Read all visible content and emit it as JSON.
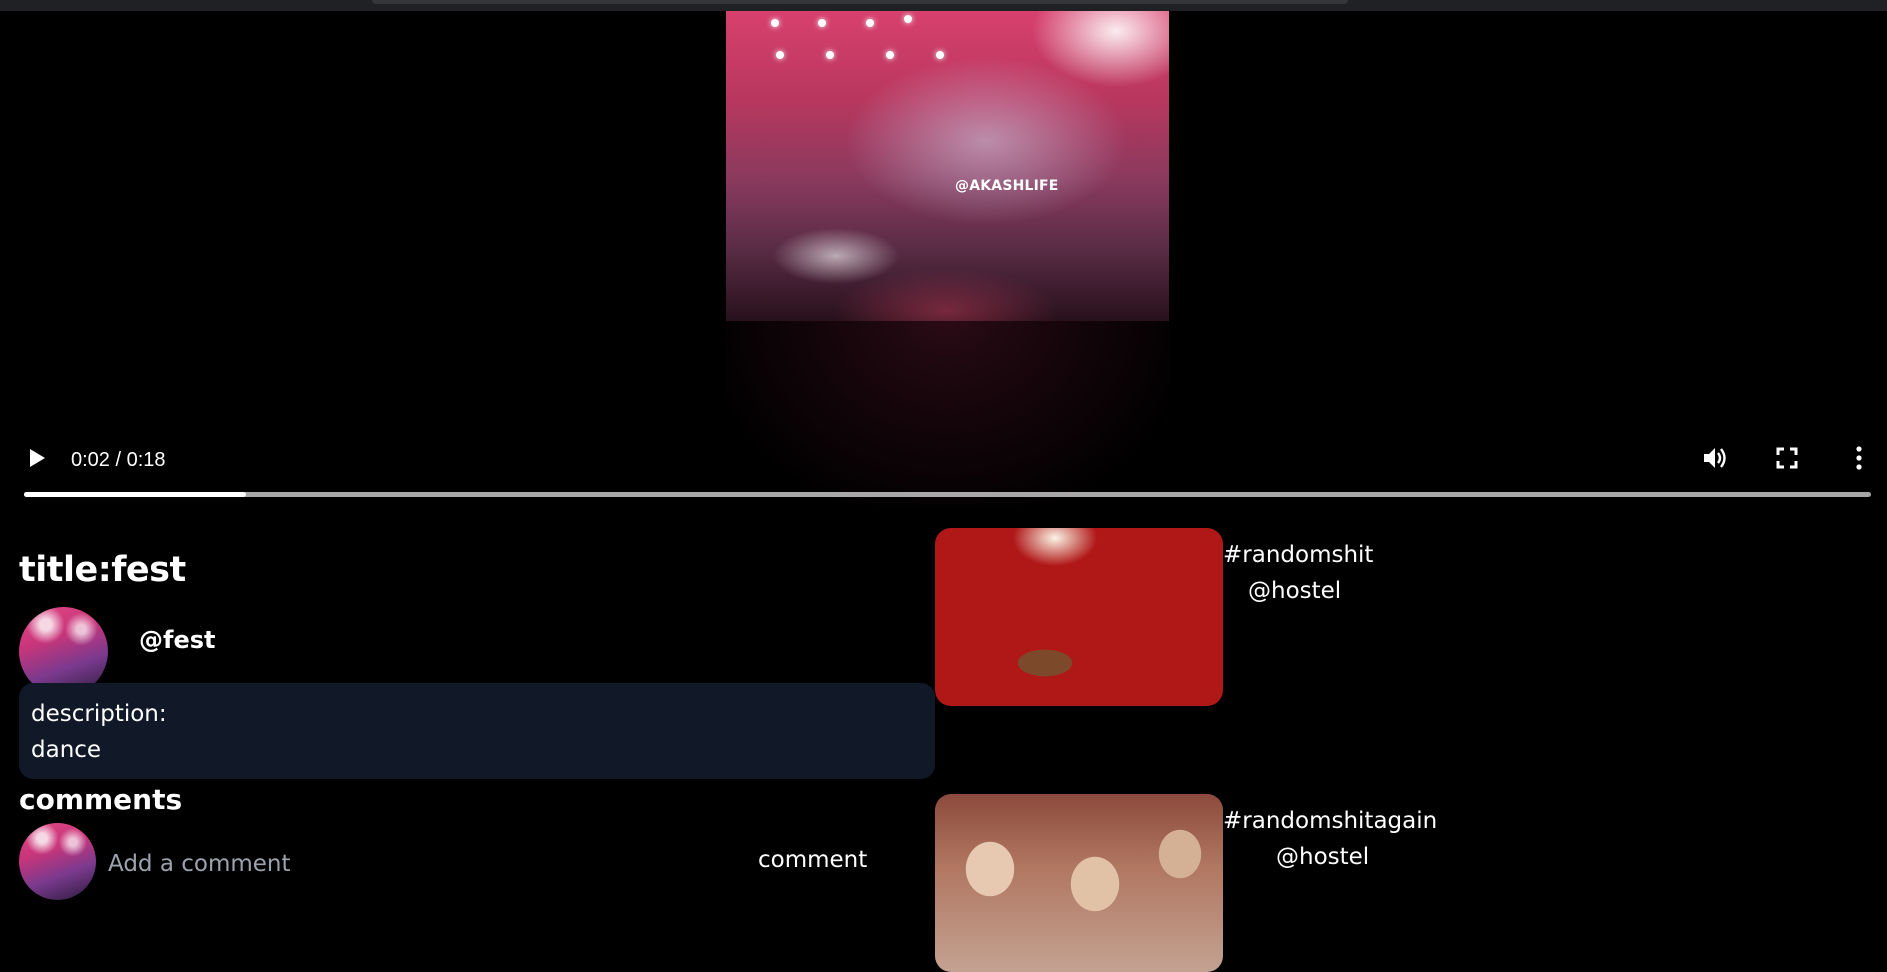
{
  "player": {
    "watermark": "@AKASHLIFE",
    "time": "0:02 / 0:18",
    "progress": 0.12,
    "controls": {
      "play": "play-icon",
      "volume": "volume-icon",
      "fullscreen": "fullscreen-icon",
      "more": "more-options-icon"
    }
  },
  "video": {
    "title": "title:fest",
    "channel_handle": "@fest",
    "description_label": "description:",
    "description": "dance"
  },
  "comments": {
    "heading": "comments",
    "placeholder": "Add a comment",
    "submit_label": "comment"
  },
  "recommendations": [
    {
      "tag": "#randomshit",
      "channel": "@hostel"
    },
    {
      "tag": "#randomshitagain",
      "channel": "@hostel"
    }
  ],
  "colors": {
    "background": "#000000",
    "description_bg": "#111827",
    "progress_track": "#a8a8a8",
    "progress_fill": "#ffffff",
    "placeholder": "#9ca3af"
  }
}
